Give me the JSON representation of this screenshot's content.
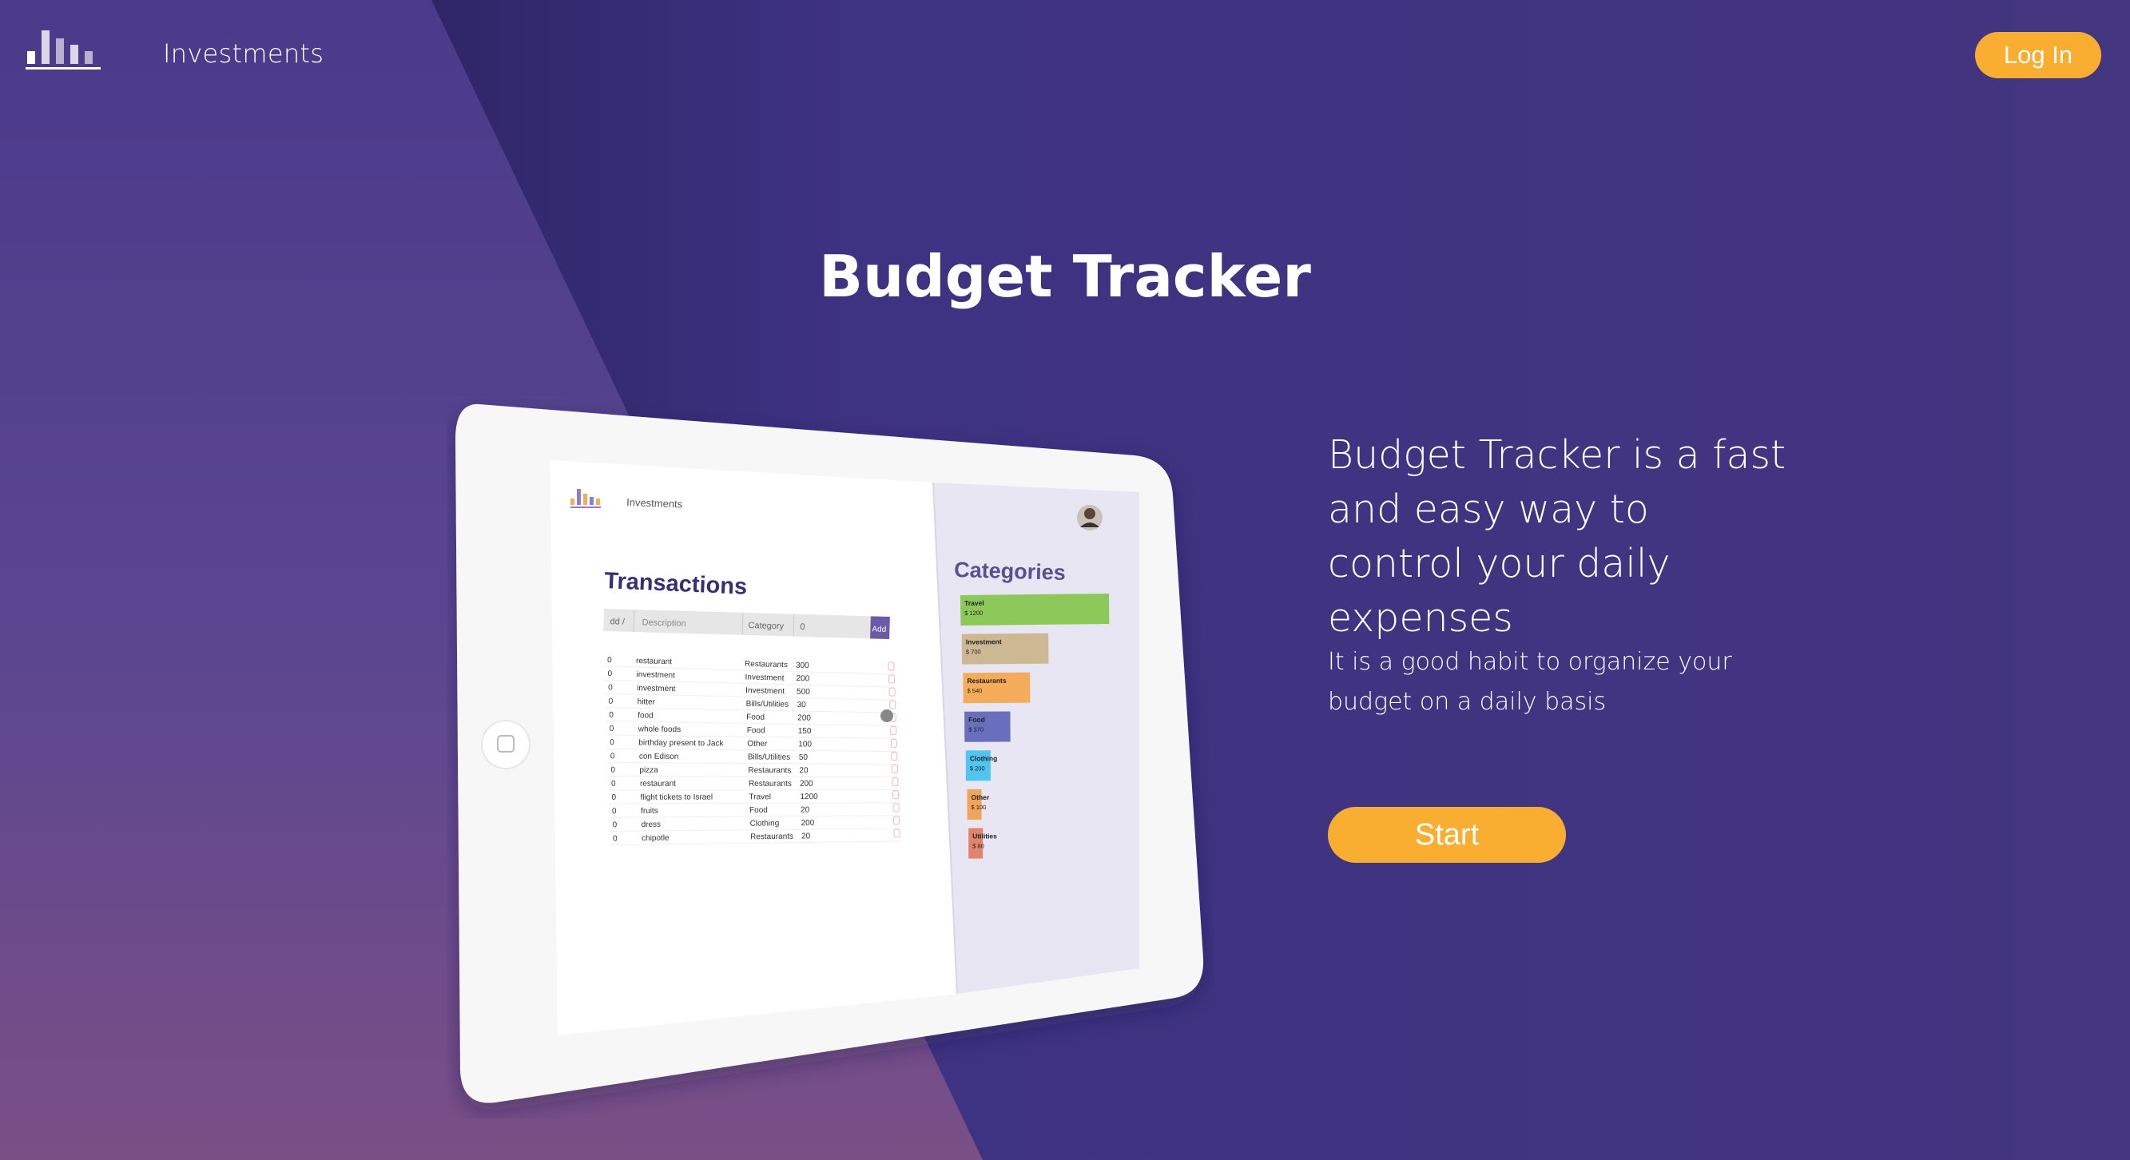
{
  "nav": {
    "brand": "Investments",
    "login_label": "Log In"
  },
  "hero": {
    "title": "Budget Tracker",
    "tagline": "Budget Tracker is a fast and easy way to control your daily expenses",
    "subline": "It is a good habit to organize your budget on a daily basis",
    "start_label": "Start"
  },
  "colors": {
    "background": "#42347f",
    "accent": "#f9ae32",
    "text": "#ffffff"
  },
  "tablet_screen": {
    "brand": "Investments",
    "transactions_title": "Transactions",
    "headers": {
      "day": "dd /",
      "description": "Description",
      "category": "Category",
      "amount": "0",
      "add": "Add"
    },
    "rows": [
      {
        "day": "0",
        "description": "restaurant",
        "category": "Restaurants",
        "amount": "300"
      },
      {
        "day": "0",
        "description": "investment",
        "category": "Investment",
        "amount": "200"
      },
      {
        "day": "0",
        "description": "investment",
        "category": "Investment",
        "amount": "500"
      },
      {
        "day": "0",
        "description": "hitter",
        "category": "Bills/Utilities",
        "amount": "30"
      },
      {
        "day": "0",
        "description": "food",
        "category": "Food",
        "amount": "200"
      },
      {
        "day": "0",
        "description": "whole foods",
        "category": "Food",
        "amount": "150"
      },
      {
        "day": "0",
        "description": "birthday present to Jack",
        "category": "Other",
        "amount": "100"
      },
      {
        "day": "0",
        "description": "con Edison",
        "category": "Bills/Utilities",
        "amount": "50"
      },
      {
        "day": "0",
        "description": "pizza",
        "category": "Restaurants",
        "amount": "20"
      },
      {
        "day": "0",
        "description": "restaurant",
        "category": "Restaurants",
        "amount": "200"
      },
      {
        "day": "0",
        "description": "flight tickets to Israel",
        "category": "Travel",
        "amount": "1200"
      },
      {
        "day": "0",
        "description": "fruits",
        "category": "Food",
        "amount": "20"
      },
      {
        "day": "0",
        "description": "dress",
        "category": "Clothing",
        "amount": "200"
      },
      {
        "day": "0",
        "description": "chipotle",
        "category": "Restaurants",
        "amount": "20"
      }
    ],
    "categories_title": "Categories",
    "categories": [
      {
        "name": "Travel",
        "amount": "$ 1200",
        "value": 1200,
        "color": "#8dc85a"
      },
      {
        "name": "Investment",
        "amount": "$ 700",
        "value": 700,
        "color": "#cdb894"
      },
      {
        "name": "Restaurants",
        "amount": "$ 540",
        "value": 540,
        "color": "#f5ac5a"
      },
      {
        "name": "Food",
        "amount": "$ 370",
        "value": 370,
        "color": "#6a6fbd"
      },
      {
        "name": "Clothing",
        "amount": "$ 200",
        "value": 200,
        "color": "#4fc5f0"
      },
      {
        "name": "Other",
        "amount": "$ 100",
        "value": 100,
        "color": "#f2a45c"
      },
      {
        "name": "Utilities",
        "amount": "$ 80",
        "value": 80,
        "color": "#e1846e"
      }
    ]
  }
}
